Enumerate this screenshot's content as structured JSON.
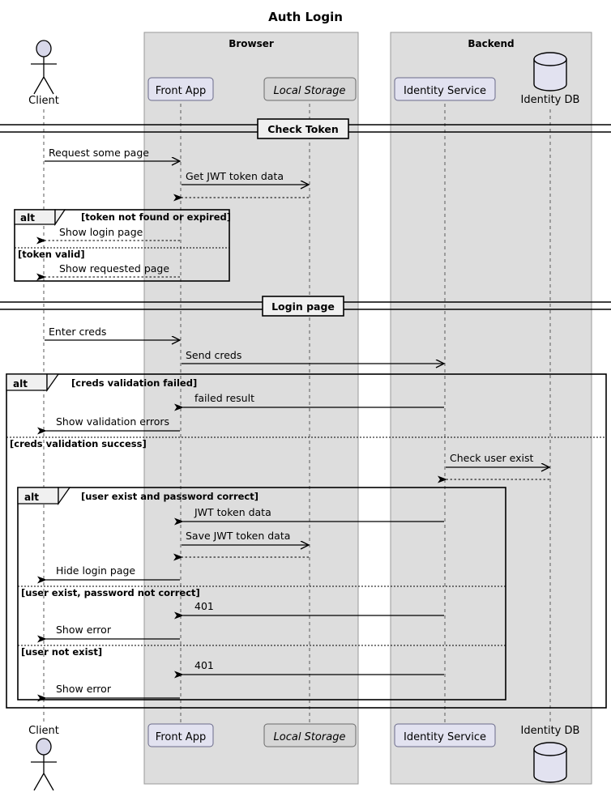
{
  "title": "Auth Login",
  "groups": [
    {
      "name": "Browser",
      "label": "Browser"
    },
    {
      "name": "Backend",
      "label": "Backend"
    }
  ],
  "participants": [
    {
      "id": "client",
      "label": "Client",
      "kind": "actor"
    },
    {
      "id": "front_app",
      "label": "Front App",
      "kind": "participant"
    },
    {
      "id": "local_storage",
      "label": "Local Storage",
      "kind": "participant-italic"
    },
    {
      "id": "identity_service",
      "label": "Identity Service",
      "kind": "participant"
    },
    {
      "id": "identity_db",
      "label": "Identity DB",
      "kind": "database"
    }
  ],
  "dividers": [
    {
      "label": "Check Token"
    },
    {
      "label": "Login page"
    }
  ],
  "messages": [
    {
      "text": "Request some page",
      "from": "client",
      "to": "front_app",
      "style": "solid"
    },
    {
      "text": "Get JWT token data",
      "from": "front_app",
      "to": "local_storage",
      "style": "solid"
    },
    {
      "text": "",
      "from": "local_storage",
      "to": "front_app",
      "style": "dashed"
    },
    {
      "text": "Show login page",
      "from": "front_app",
      "to": "client",
      "style": "dashed"
    },
    {
      "text": "Show requested page",
      "from": "front_app",
      "to": "client",
      "style": "dashed"
    },
    {
      "text": "Enter creds",
      "from": "client",
      "to": "front_app",
      "style": "solid"
    },
    {
      "text": "Send creds",
      "from": "front_app",
      "to": "identity_service",
      "style": "solid"
    },
    {
      "text": "failed result",
      "from": "identity_service",
      "to": "front_app",
      "style": "solid"
    },
    {
      "text": "Show validation errors",
      "from": "front_app",
      "to": "client",
      "style": "solid"
    },
    {
      "text": "Check user exist",
      "from": "identity_service",
      "to": "identity_db",
      "style": "solid"
    },
    {
      "text": "",
      "from": "identity_db",
      "to": "identity_service",
      "style": "dashed"
    },
    {
      "text": "JWT token data",
      "from": "identity_service",
      "to": "front_app",
      "style": "solid"
    },
    {
      "text": "Save JWT token data",
      "from": "front_app",
      "to": "local_storage",
      "style": "solid"
    },
    {
      "text": "",
      "from": "local_storage",
      "to": "front_app",
      "style": "dashed"
    },
    {
      "text": "Hide login page",
      "from": "front_app",
      "to": "client",
      "style": "solid"
    },
    {
      "text": "401",
      "from": "identity_service",
      "to": "front_app",
      "style": "solid"
    },
    {
      "text": "Show error",
      "from": "front_app",
      "to": "client",
      "style": "solid"
    },
    {
      "text": "401",
      "from": "identity_service",
      "to": "front_app",
      "style": "solid"
    },
    {
      "text": "Show error",
      "from": "front_app",
      "to": "client",
      "style": "solid"
    }
  ],
  "fragments": [
    {
      "keyword": "alt",
      "branches": [
        "[token not found or expired]",
        "[token valid]"
      ]
    },
    {
      "keyword": "alt",
      "branches": [
        "[creds validation failed]",
        "[creds validation success]"
      ]
    },
    {
      "keyword": "alt",
      "branches": [
        "[user exist and password correct]",
        "[user exist, password not correct]",
        "[user not exist]"
      ]
    }
  ],
  "labels": {
    "alt_keyword": "alt",
    "title": "Auth Login",
    "browser": "Browser",
    "backend": "Backend",
    "client": "Client",
    "front_app": "Front App",
    "local_storage": "Local Storage",
    "identity_service": "Identity Service",
    "identity_db": "Identity DB",
    "div_check_token": "Check Token",
    "div_login_page": "Login page",
    "m_request_some_page": "Request some page",
    "m_get_jwt": "Get JWT token data",
    "m_show_login_page": "Show login page",
    "m_show_requested_page": "Show requested page",
    "m_enter_creds": "Enter creds",
    "m_send_creds": "Send creds",
    "m_failed_result": "failed result",
    "m_show_validation_errors": "Show validation errors",
    "m_check_user_exist": "Check user exist",
    "m_jwt_token_data": "JWT token data",
    "m_save_jwt": "Save JWT token data",
    "m_hide_login_page": "Hide login page",
    "m_401_a": "401",
    "m_show_error_a": "Show error",
    "m_401_b": "401",
    "m_show_error_b": "Show error",
    "c_token_not_found": "[token not found or expired]",
    "c_token_valid": "[token valid]",
    "c_creds_failed": "[creds validation failed]",
    "c_creds_success": "[creds validation success]",
    "c_user_pass_ok": "[user exist and password correct]",
    "c_user_pass_bad": "[user exist, password not correct]",
    "c_user_not_exist": "[user not exist]"
  },
  "colors": {
    "group_fill": "#dddddd",
    "participant_fill": "#e2e2f0",
    "participant_alt_fill": "#d6d6d6",
    "line": "#000000",
    "lifeline": "#5a5a5a",
    "fragment_header_fill": "#f0f0f0"
  }
}
